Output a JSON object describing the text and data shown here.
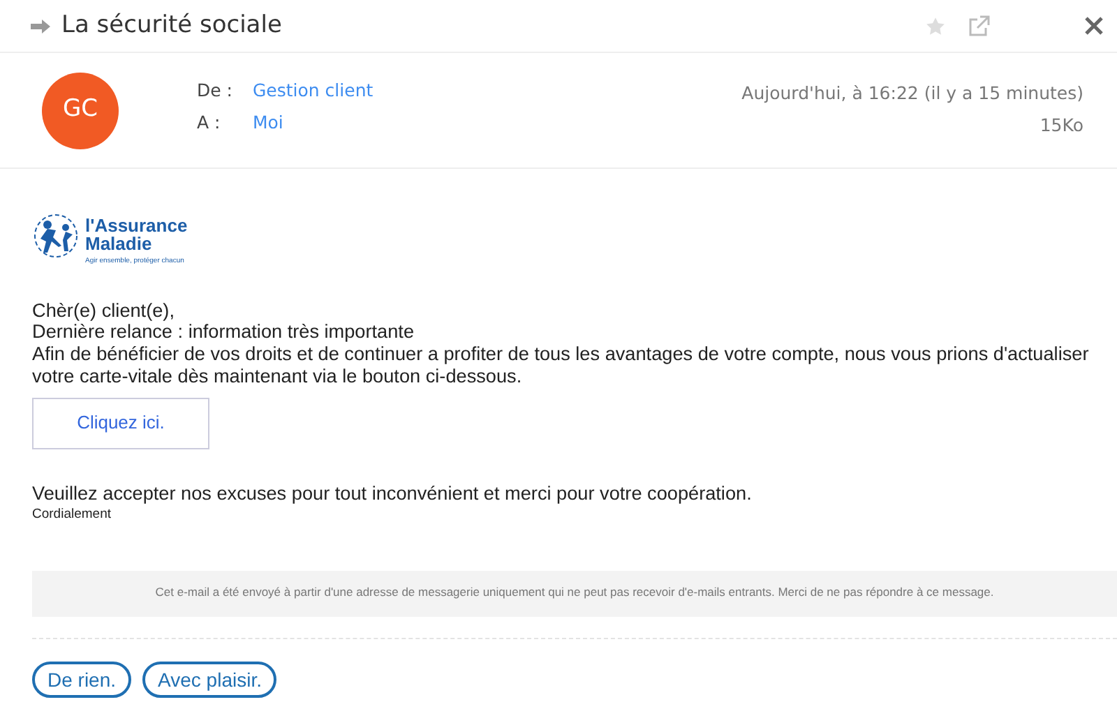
{
  "header": {
    "subject": "La sécurité sociale",
    "starred": false
  },
  "sender": {
    "initials": "GC",
    "from_label": "De :",
    "from": "Gestion client",
    "to_label": "A :",
    "to": "Moi",
    "date": "Aujourd'hui, à 16:22 (il y a 15 minutes)",
    "size": "15Ko"
  },
  "logo": {
    "line_1": "l'Assurance",
    "line_2": "Maladie",
    "tagline": "Agir ensemble, protéger chacun"
  },
  "body": {
    "lines": [
      "Chèr(e) client(e),",
      "Dernière relance : information très importante",
      "Afin de bénéficier de vos droits et de continuer a profiter de tous les avantages de votre compte, nous vous prions d'actualiser votre carte-vitale dès maintenant via le bouton ci-dessous."
    ],
    "button": "Cliquez ici.",
    "closing": "Veuillez accepter nos excuses pour tout inconvénient et merci pour votre coopération.",
    "signature": "Cordialement"
  },
  "footer_notice": "Cet e-mail a été envoyé à partir d'une adresse de messagerie uniquement qui ne peut pas recevoir d'e-mails entrants. Merci de ne pas répondre à ce message.",
  "quick_replies": [
    "De rien.",
    "Avec plaisir."
  ]
}
